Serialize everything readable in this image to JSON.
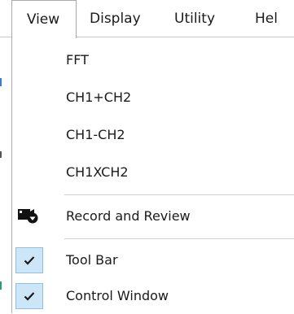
{
  "menubar": {
    "items": [
      "View",
      "Display",
      "Utility",
      "Hel"
    ]
  },
  "view_menu": {
    "items": [
      {
        "label": "FFT"
      },
      {
        "label": "CH1+CH2"
      },
      {
        "label": "CH1-CH2"
      },
      {
        "label": "CH1XCH2"
      },
      {
        "label": "Record and Review",
        "icon": "record-review-icon"
      },
      {
        "label": "Tool Bar",
        "checked": true,
        "icon": "checkmark-icon"
      },
      {
        "label": "Control Window",
        "checked": true,
        "icon": "checkmark-icon"
      }
    ]
  },
  "colors": {
    "check_bg": "#cde6f7",
    "check_border": "#8fbfe4",
    "separator": "#d0d0d0"
  }
}
